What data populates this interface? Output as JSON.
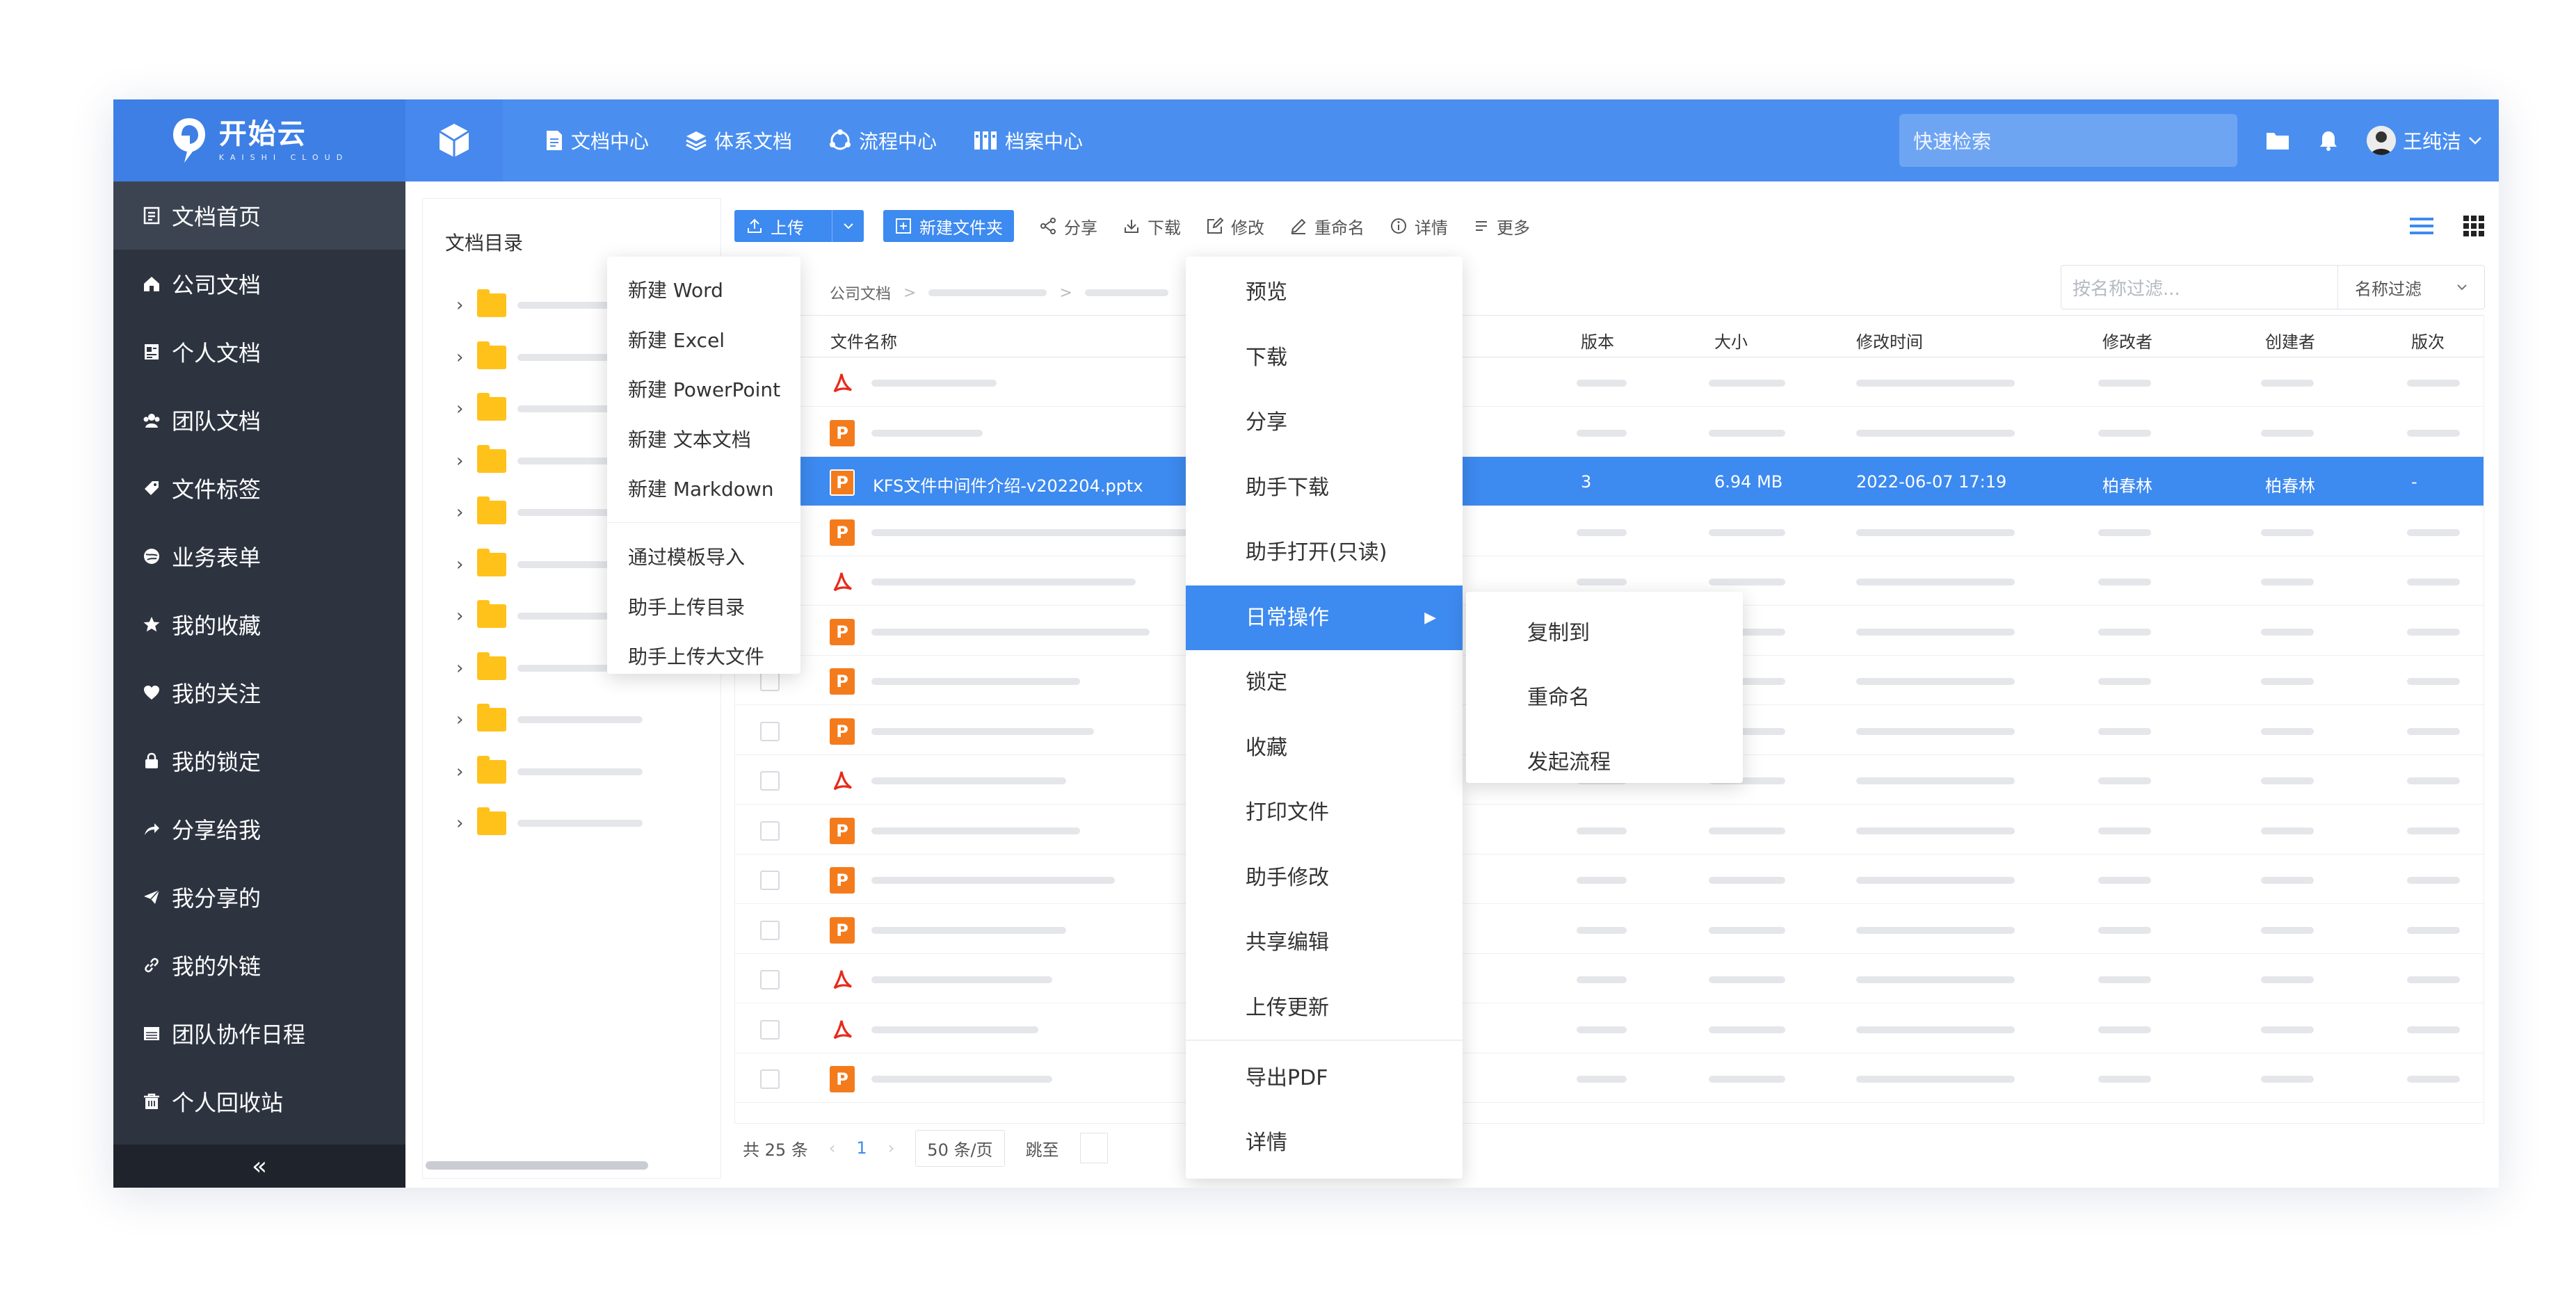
{
  "brand": {
    "name": "开始云",
    "sub": "KAISHI CLOUD"
  },
  "topnav": {
    "items": [
      {
        "label": "文档中心",
        "icon": "document-icon"
      },
      {
        "label": "体系文档",
        "icon": "layers-icon"
      },
      {
        "label": "流程中心",
        "icon": "flow-icon"
      },
      {
        "label": "档案中心",
        "icon": "archive-icon"
      }
    ],
    "search_placeholder": "快速检索",
    "user_name": "王纯洁"
  },
  "sidebar": {
    "items": [
      {
        "label": "文档首页",
        "icon": "home-doc-icon"
      },
      {
        "label": "公司文档",
        "icon": "house-icon"
      },
      {
        "label": "个人文档",
        "icon": "personal-doc-icon"
      },
      {
        "label": "团队文档",
        "icon": "team-icon"
      },
      {
        "label": "文件标签",
        "icon": "tag-icon"
      },
      {
        "label": "业务表单",
        "icon": "form-icon"
      },
      {
        "label": "我的收藏",
        "icon": "star-icon"
      },
      {
        "label": "我的关注",
        "icon": "heart-icon"
      },
      {
        "label": "我的锁定",
        "icon": "lock-icon"
      },
      {
        "label": "分享给我",
        "icon": "share-icon"
      },
      {
        "label": "我分享的",
        "icon": "send-icon"
      },
      {
        "label": "我的外链",
        "icon": "link-icon"
      },
      {
        "label": "团队协作日程",
        "icon": "calendar-icon"
      },
      {
        "label": "个人回收站",
        "icon": "trash-icon"
      }
    ],
    "collapse_label": "«"
  },
  "tree": {
    "title": "文档目录"
  },
  "toolbar": {
    "upload": "上传",
    "new_folder": "新建文件夹",
    "share": "分享",
    "download": "下载",
    "edit": "修改",
    "rename": "重命名",
    "details": "详情",
    "more": "更多"
  },
  "breadcrumb": {
    "root": "公司文档"
  },
  "filter": {
    "placeholder": "按名称过滤...",
    "select": "名称过滤"
  },
  "table": {
    "columns": {
      "name": "文件名称",
      "version": "版本",
      "size": "大小",
      "modified": "修改时间",
      "modifier": "修改者",
      "creator": "创建者",
      "revision": "版次"
    },
    "selected_row": {
      "name": "KFS文件中间件介绍-v202204.pptx",
      "version": "3",
      "size": "6.94 MB",
      "modified": "2022-06-07 17:19",
      "modifier": "柏春林",
      "creator": "柏春林",
      "revision": "-"
    },
    "file_types": [
      "pdf",
      "ppt",
      "ppt",
      "ppt",
      "pdf",
      "ppt",
      "ppt",
      "ppt",
      "pdf",
      "ppt",
      "ppt",
      "ppt",
      "pdf",
      "pdf",
      "ppt"
    ]
  },
  "pager": {
    "total": "共 25 条",
    "page": "1",
    "size": "50 条/页",
    "jump": "跳至"
  },
  "new_menu": {
    "items": [
      "新建 Word",
      "新建 Excel",
      "新建 PowerPoint",
      "新建 文本文档",
      "新建 Markdown",
      "通过模板导入",
      "助手上传目录",
      "助手上传大文件"
    ]
  },
  "context_menu": {
    "items": [
      "预览",
      "下载",
      "分享",
      "助手下载",
      "助手打开(只读)",
      "日常操作",
      "锁定",
      "收藏",
      "打印文件",
      "助手修改",
      "共享编辑",
      "上传更新",
      "导出PDF",
      "详情"
    ]
  },
  "sub_menu": {
    "items": [
      "复制到",
      "重命名",
      "发起流程"
    ]
  },
  "colors": {
    "primary": "#3d8af0",
    "header": "#4a8ff0",
    "sidebar": "#2d3440",
    "folder": "#ffc21a",
    "ppt": "#f47b1c",
    "pdf": "#e62b1c"
  }
}
